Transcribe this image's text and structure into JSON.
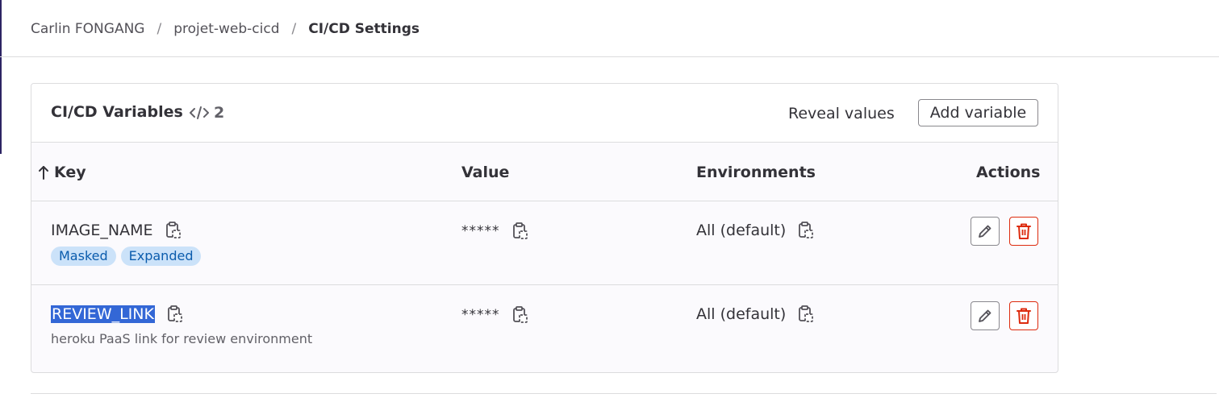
{
  "breadcrumb": {
    "items": [
      "Carlin FONGANG",
      "projet-web-cicd"
    ],
    "current": "CI/CD Settings",
    "separator": "/"
  },
  "variables_card": {
    "title": "CI/CD Variables",
    "count_icon": "code-icon",
    "count": "2",
    "reveal_label": "Reveal values",
    "add_label": "Add variable"
  },
  "table": {
    "headers": {
      "key": "Key",
      "value": "Value",
      "environments": "Environments",
      "actions": "Actions"
    },
    "sort_icon": "arrow-up-icon",
    "rows": [
      {
        "key": "IMAGE_NAME",
        "value": "*****",
        "environment": "All (default)",
        "badges": [
          "Masked",
          "Expanded"
        ],
        "description": ""
      },
      {
        "key": "REVIEW_LINK",
        "value": "*****",
        "environment": "All (default)",
        "badges": [],
        "description": "heroku PaaS link for review environment"
      }
    ]
  },
  "colors": {
    "badge_bg": "#cbe2f9",
    "badge_text": "#0b5cad",
    "delete": "#dd2b0e",
    "selection": "#3367d6"
  }
}
